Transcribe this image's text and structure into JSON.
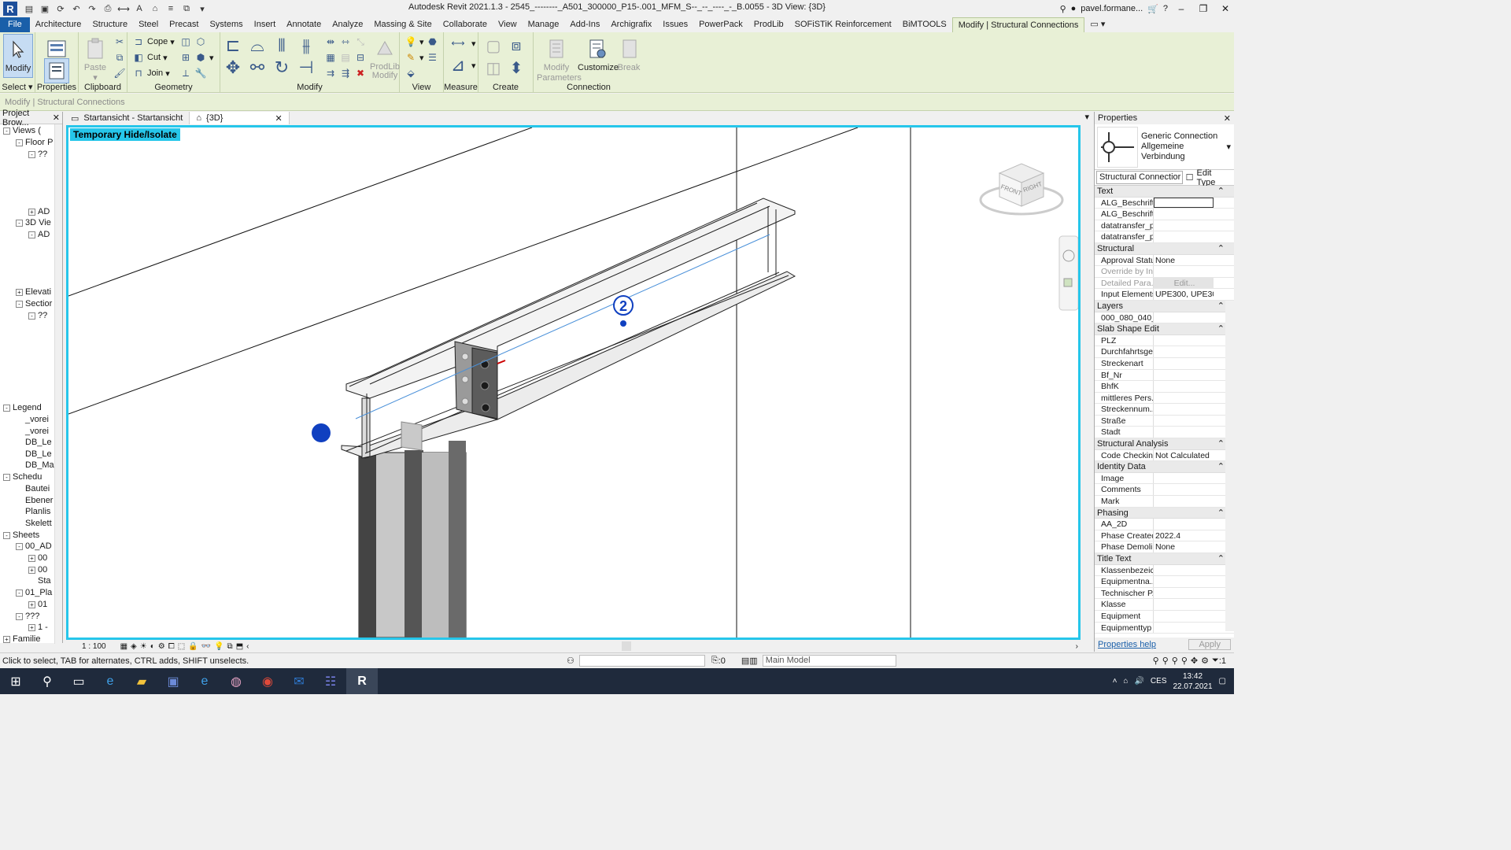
{
  "app": {
    "window_title": "Autodesk Revit 2021.1.3 - 2545_--------_A501_300000_P15-.001_MFM_S--_--_----_-_B.0055 - 3D View: {3D}",
    "user": "pavel.formane..."
  },
  "ribbon": {
    "tabs": [
      "File",
      "Architecture",
      "Structure",
      "Steel",
      "Precast",
      "Systems",
      "Insert",
      "Annotate",
      "Analyze",
      "Massing & Site",
      "Collaborate",
      "View",
      "Manage",
      "Add-Ins",
      "Archigrafix",
      "Issues",
      "PowerPack",
      "ProdLib",
      "SOFiSTiK Reinforcement",
      "BiMTOOLS",
      "Modify | Structural Connections"
    ],
    "active_tab": "Modify | Structural Connections",
    "modify_label": "Modify",
    "select_label": "Select",
    "properties_label": "Properties",
    "paste_label": "Paste",
    "clipboard_label": "Clipboard",
    "cope_label": "Cope",
    "cut_label": "Cut",
    "join_label": "Join",
    "geometry_label": "Geometry",
    "prodlib_label": "ProdLib Modify",
    "modify_panel_label": "Modify",
    "view_label": "View",
    "measure_label": "Measure",
    "create_label": "Create",
    "modify_params_label": "Modify Parameters",
    "customize_label": "Customize",
    "break_label": "Break",
    "connection_label": "Connection"
  },
  "context_bar": "Modify | Structural Connections",
  "browser": {
    "title": "Project Brow...",
    "items": [
      {
        "label": "Views (",
        "indent": 0,
        "exp": "-"
      },
      {
        "label": "Floor P",
        "indent": 1,
        "exp": "-"
      },
      {
        "label": "??",
        "indent": 2,
        "exp": "-"
      },
      {
        "label": "AD",
        "indent": 2,
        "exp": "+"
      },
      {
        "label": "3D Vie",
        "indent": 1,
        "exp": "-"
      },
      {
        "label": "AD",
        "indent": 2,
        "exp": "-"
      },
      {
        "label": "Elevati",
        "indent": 1,
        "exp": "+"
      },
      {
        "label": "Sectior",
        "indent": 1,
        "exp": "-"
      },
      {
        "label": "??",
        "indent": 2,
        "exp": "-"
      },
      {
        "label": "Legend",
        "indent": 0,
        "exp": "-"
      },
      {
        "label": "_vorei",
        "indent": 1,
        "exp": ""
      },
      {
        "label": "_vorei",
        "indent": 1,
        "exp": ""
      },
      {
        "label": "DB_Le",
        "indent": 1,
        "exp": ""
      },
      {
        "label": "DB_Le",
        "indent": 1,
        "exp": ""
      },
      {
        "label": "DB_Ma",
        "indent": 1,
        "exp": ""
      },
      {
        "label": "Schedu",
        "indent": 0,
        "exp": "-"
      },
      {
        "label": "Bautei",
        "indent": 1,
        "exp": ""
      },
      {
        "label": "Ebener",
        "indent": 1,
        "exp": ""
      },
      {
        "label": "Planlis",
        "indent": 1,
        "exp": ""
      },
      {
        "label": "Skelett",
        "indent": 1,
        "exp": ""
      },
      {
        "label": "Sheets",
        "indent": 0,
        "exp": "-"
      },
      {
        "label": "00_AD",
        "indent": 1,
        "exp": "-"
      },
      {
        "label": "00",
        "indent": 2,
        "exp": "+"
      },
      {
        "label": "00",
        "indent": 2,
        "exp": "+"
      },
      {
        "label": "Sta",
        "indent": 2,
        "exp": ""
      },
      {
        "label": "01_Pla",
        "indent": 1,
        "exp": "-"
      },
      {
        "label": "01",
        "indent": 2,
        "exp": "+"
      },
      {
        "label": "???",
        "indent": 1,
        "exp": "-"
      },
      {
        "label": "1 -",
        "indent": 2,
        "exp": "+"
      },
      {
        "label": "Familie",
        "indent": 0,
        "exp": "+"
      }
    ]
  },
  "view_tabs": [
    "Startansicht - Startansicht",
    "{3D}"
  ],
  "canvas": {
    "banner": "Temporary Hide/Isolate",
    "marker_number": "2",
    "viewcube_front": "FRONT",
    "viewcube_right": "RIGHT"
  },
  "view_control": {
    "scale": "1 : 100"
  },
  "properties": {
    "title": "Properties",
    "type_line1": "Generic Connection",
    "type_line2": "Allgemeine Verbindung",
    "filter_value": "Structural Connectior",
    "edit_type": "Edit Type",
    "groups": [
      {
        "name": "Text",
        "rows": [
          [
            "ALG_Beschrift...",
            ""
          ],
          [
            "ALG_Beschrift...",
            ""
          ],
          [
            "datatransfer_p...",
            ""
          ],
          [
            "datatransfer_p...",
            ""
          ]
        ]
      },
      {
        "name": "Structural",
        "rows": [
          [
            "Approval Status",
            "None"
          ],
          [
            "Override by In...",
            ""
          ],
          [
            "Detailed Para...",
            "Edit..."
          ],
          [
            "Input Elements",
            "UPE300, UPE300"
          ]
        ]
      },
      {
        "name": "Layers",
        "rows": [
          [
            "000_080_040_...",
            ""
          ]
        ]
      },
      {
        "name": "Slab Shape Edit",
        "rows": [
          [
            "PLZ",
            ""
          ],
          [
            "Durchfahrtsge...",
            ""
          ],
          [
            "Streckenart",
            ""
          ],
          [
            "Bf_Nr",
            ""
          ],
          [
            "BhfK",
            ""
          ],
          [
            "mittleres Pers...",
            ""
          ],
          [
            "Streckennum...",
            ""
          ],
          [
            "Straße",
            ""
          ],
          [
            "Stadt",
            ""
          ]
        ]
      },
      {
        "name": "Structural Analysis",
        "rows": [
          [
            "Code Checkin...",
            "Not Calculated"
          ]
        ]
      },
      {
        "name": "Identity Data",
        "rows": [
          [
            "Image",
            ""
          ],
          [
            "Comments",
            ""
          ],
          [
            "Mark",
            ""
          ]
        ]
      },
      {
        "name": "Phasing",
        "rows": [
          [
            "AA_2D",
            ""
          ],
          [
            "Phase Created",
            "2022.4"
          ],
          [
            "Phase Demoli...",
            "None"
          ]
        ]
      },
      {
        "name": "Title Text",
        "rows": [
          [
            "Klassenbezeic...",
            ""
          ],
          [
            "Equipmentna...",
            ""
          ],
          [
            "Technischer P...",
            ""
          ],
          [
            "Klasse",
            ""
          ],
          [
            "Equipment",
            ""
          ],
          [
            "Equipmenttyp",
            ""
          ]
        ]
      }
    ],
    "help_link": "Properties help",
    "apply": "Apply"
  },
  "status": {
    "message": "Click to select, TAB for alternates, CTRL adds, SHIFT unselects.",
    "count": ":0",
    "main_model": "Main Model",
    "filter_count": ":1"
  },
  "taskbar": {
    "lang": "CES",
    "time": "13:42",
    "date": "22.07.2021"
  },
  "colors": {
    "accent": "#26c6ea",
    "ribbon": "#e8f0d6",
    "file_tab": "#1a5fa9",
    "marker": "#1040c0"
  }
}
